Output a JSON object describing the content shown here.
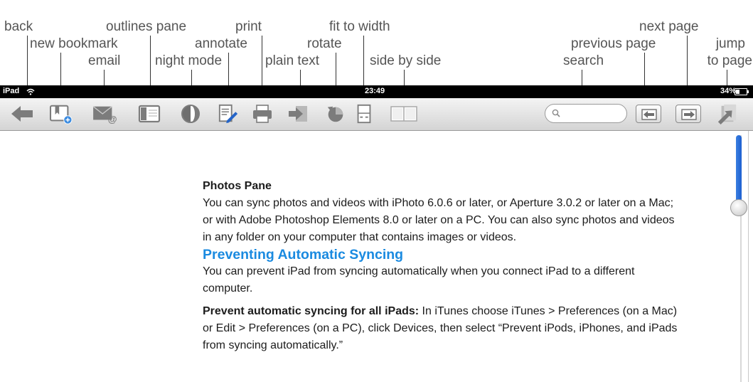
{
  "annotations": {
    "back": "back",
    "new_bookmark": "new bookmark",
    "email": "email",
    "outlines_pane": "outlines pane",
    "night_mode": "night mode",
    "annotate": "annotate",
    "print": "print",
    "plain_text": "plain text",
    "rotate": "rotate",
    "fit_to_width": "fit to width",
    "side_by_side": "side by side",
    "search": "search",
    "previous_page": "previous page",
    "next_page": "next page",
    "jump_to_page_1": "jump",
    "jump_to_page_2": "to page"
  },
  "status_bar": {
    "device": "iPad",
    "time": "23:49",
    "battery": "34%"
  },
  "toolbar": {
    "search": {
      "value": "",
      "placeholder": ""
    },
    "icons": [
      "back-arrow-icon",
      "new-bookmark-icon",
      "email-icon",
      "outlines-pane-icon",
      "night-mode-icon",
      "annotate-icon",
      "print-icon",
      "plain-text-icon",
      "rotate-icon",
      "fit-to-width-icon",
      "side-by-side-icon",
      "search-icon",
      "previous-page-icon",
      "next-page-icon",
      "jump-to-page-icon"
    ]
  },
  "document": {
    "section1_title": "Photos Pane",
    "section1_body": "You can sync photos and videos with iPhoto 6.0.6 or later, or Aperture 3.0.2 or later on a Mac; or with Adobe Photoshop Elements 8.0 or later on a PC. You can also sync photos and videos in any folder on your computer that contains images or videos.",
    "section2_heading": "Preventing Automatic Syncing",
    "section2_body": "You can prevent iPad from syncing automatically when you connect iPad to a different computer.",
    "section3_label": "Prevent automatic syncing for all iPads:",
    "section3_body": " In iTunes choose iTunes > Preferences (on a Mac) or Edit > Preferences (on a PC), click Devices, then select “Prevent iPods, iPhones, and iPads from syncing automatically.”"
  },
  "colors": {
    "heading_blue": "#1a8ae0",
    "scrollbar_blue": "#2a6fd8",
    "status_bar": "#000000",
    "icon_gray": "#7c7c7c"
  }
}
